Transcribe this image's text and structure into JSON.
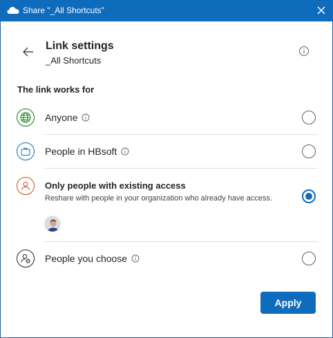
{
  "window": {
    "title": "Share \"_All Shortcuts\""
  },
  "header": {
    "title": "Link settings",
    "subtitle": "_All Shortcuts"
  },
  "section_label": "The link works for",
  "options": [
    {
      "label": "Anyone",
      "icon": "globe-icon",
      "icon_color": "#107c10",
      "selected": false,
      "has_info": true
    },
    {
      "label": "People in HBsoft",
      "icon": "briefcase-icon",
      "icon_color": "#0f6cbd",
      "selected": false,
      "has_info": true
    },
    {
      "label": "Only people with existing access",
      "description": "Reshare with people in your organization who already have access.",
      "icon": "person-icon",
      "icon_color": "#c4501c",
      "selected": true,
      "has_info": false,
      "bold": true
    },
    {
      "label": "People you choose",
      "icon": "person-gear-icon",
      "icon_color": "#242424",
      "selected": false,
      "has_info": true
    }
  ],
  "apply_label": "Apply",
  "colors": {
    "titlebar": "#0f6cbd",
    "accent": "#0f6cbd"
  }
}
